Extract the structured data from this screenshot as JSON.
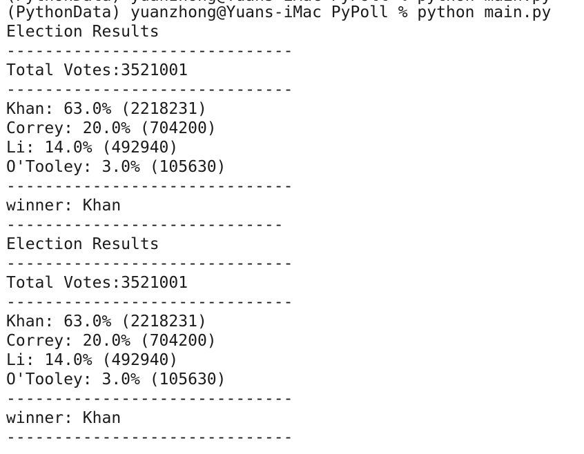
{
  "terminal": {
    "cropped_previous_line": "(PythonData) yuanzhong@Yuans-iMac PyPoll % python main.py",
    "prompt": "(PythonData) yuanzhong@Yuans-iMac PyPoll % python main.py",
    "lines": [
      "Election Results",
      "------------------------------",
      "Total Votes:3521001",
      "------------------------------",
      "Khan: 63.0% (2218231)",
      "Correy: 20.0% (704200)",
      "Li: 14.0% (492940)",
      "O'Tooley: 3.0% (105630)",
      "------------------------------",
      "winner: Khan",
      "-----------------------------",
      "Election Results",
      "------------------------------",
      "Total Votes:3521001",
      "------------------------------",
      "Khan: 63.0% (2218231)",
      "Correy: 20.0% (704200)",
      "Li: 14.0% (492940)",
      "O'Tooley: 3.0% (105630)",
      "------------------------------",
      "winner: Khan",
      "------------------------------"
    ]
  }
}
